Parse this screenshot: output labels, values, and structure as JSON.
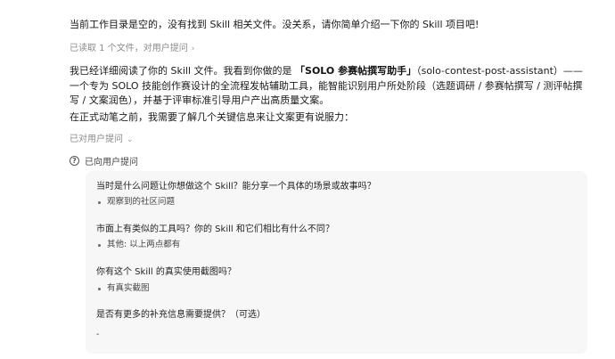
{
  "messages": {
    "intro": "当前工作目录是空的，没有找到 Skill 相关文件。没关系，请你简单介绍一下你的 Skill 项目吧!",
    "read_status": "已读取 1 个文件，对用户提问",
    "analysis_prefix": "我已经详细阅读了你的 Skill 文件。我看到你做的是 ",
    "analysis_bold": "「SOLO 参赛帖撰写助手」",
    "analysis_suffix": "（solo-contest-post-assistant）——一个专为 SOLO 技能创作赛设计的全流程发帖辅助工具，能智能识别用户所处阶段（选题调研 / 参赛帖撰写 / 测评帖撰写 / 文案润色），并基于评审标准引导用户产出高质量文案。",
    "pre_question": "在正式动笔之前，我需要了解几个关键信息来让文案更有说服力：",
    "asked_status": "已对用户提问",
    "asked_header": "已向用户提问"
  },
  "qa": [
    {
      "question": "当时是什么问题让你想做这个 Skill？能分享一个具体的场景或故事吗？",
      "answer": "观察到的社区问题"
    },
    {
      "question": "市面上有类似的工具吗？你的 Skill 和它们相比有什么不同？",
      "answer": "其他: 以上两点都有"
    },
    {
      "question": "你有这个 Skill 的真实使用截图吗？",
      "answer": "有真实截图"
    },
    {
      "question": "是否有更多的补充信息需要提供？（可选）",
      "answer": "-"
    }
  ],
  "icons": {
    "chevron_right": "chevron-right-icon",
    "chevron_down": "chevron-down-icon",
    "question": "question-circle-icon"
  }
}
